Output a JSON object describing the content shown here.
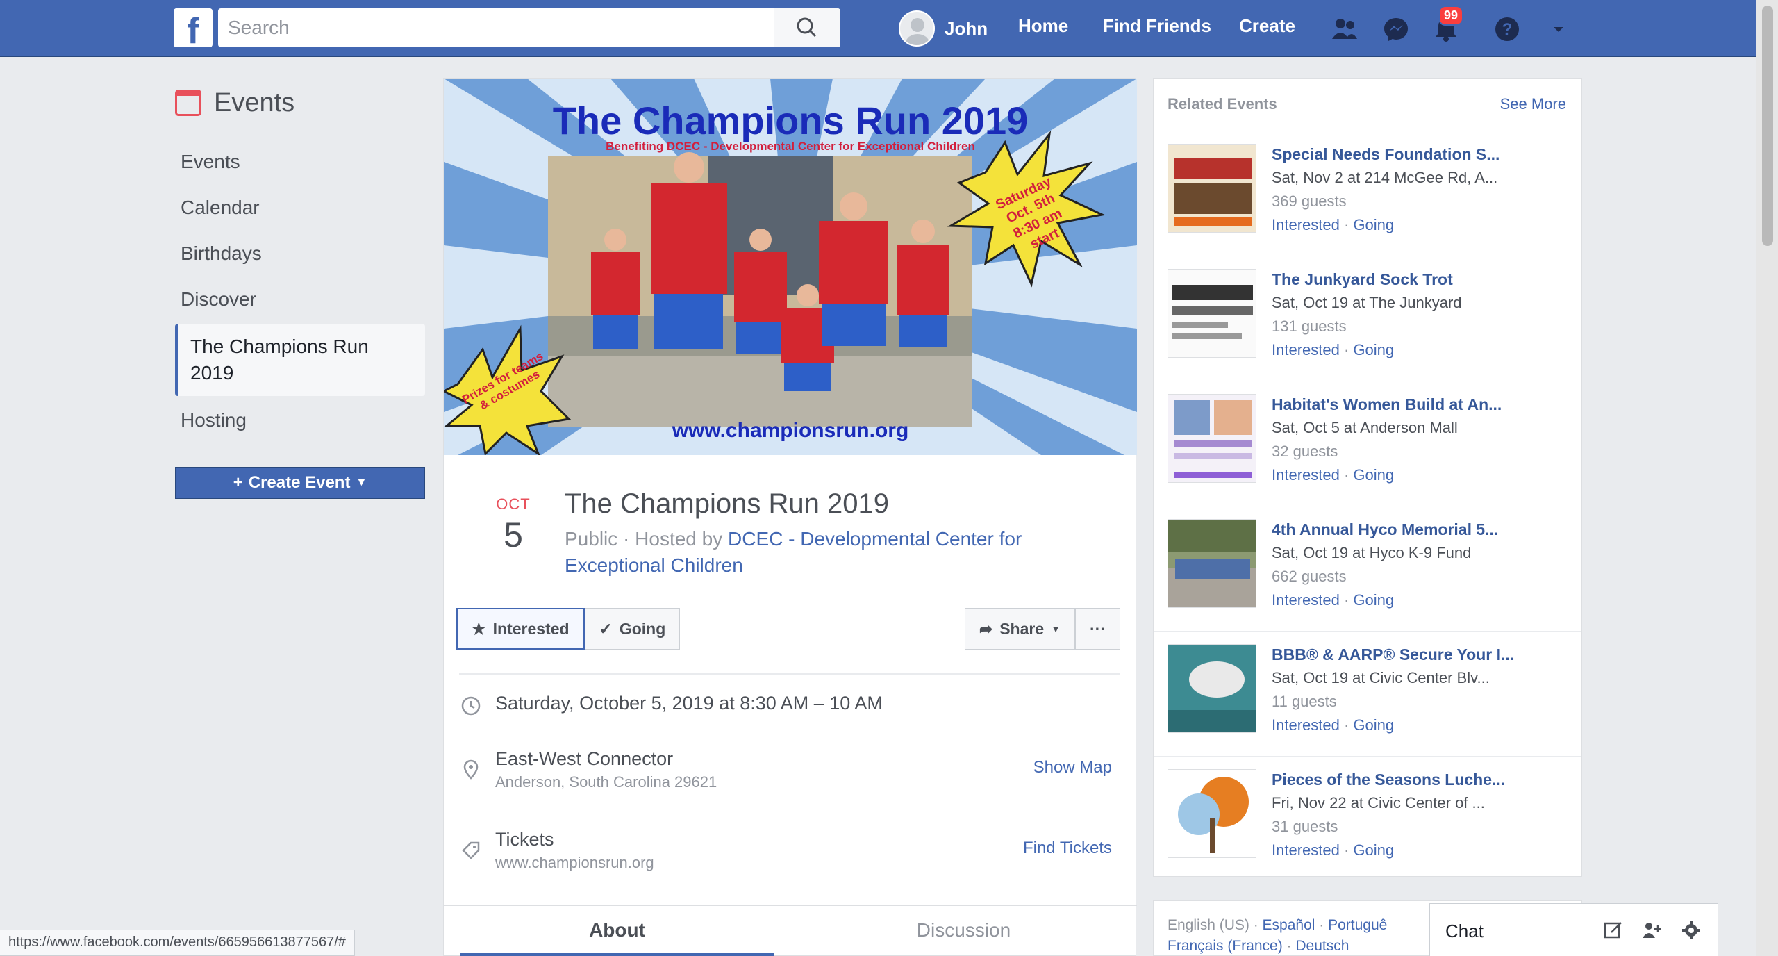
{
  "nav": {
    "logo": "f",
    "search_placeholder": "Search",
    "user_name": "John",
    "home": "Home",
    "find_friends": "Find Friends",
    "create": "Create",
    "notification_count": "99"
  },
  "left": {
    "heading": "Events",
    "items": [
      "Events",
      "Calendar",
      "Birthdays",
      "Discover"
    ],
    "active_item": "The Champions Run 2019",
    "hosting": "Hosting",
    "create_button": "Create Event"
  },
  "event": {
    "cover": {
      "title": "The Champions Run 2019",
      "subtitle": "Benefiting DCEC - Developmental Center for Exceptional Children",
      "burst_right": "Saturday Oct. 5th 8:30 am start",
      "burst_left": "Prizes for teams & costumes",
      "url": "www.championsrun.org"
    },
    "month": "OCT",
    "day": "5",
    "title": "The Champions Run 2019",
    "host_prefix": "Public · Hosted by ",
    "host_name": "DCEC - Developmental Center for Exceptional Children",
    "interested": "Interested",
    "going": "Going",
    "share": "Share",
    "more": "···",
    "datetime": "Saturday, October 5, 2019 at 8:30 AM – 10 AM",
    "location_name": "East-West Connector",
    "location_address": "Anderson, South Carolina 29621",
    "show_map": "Show Map",
    "tickets_label": "Tickets",
    "tickets_url": "www.championsrun.org",
    "find_tickets": "Find Tickets",
    "tab_about": "About",
    "tab_discussion": "Discussion"
  },
  "related": {
    "title": "Related Events",
    "see_more": "See More",
    "items": [
      {
        "name": "Special Needs Foundation S...",
        "meta": "Sat, Nov 2 at 214 McGee Rd, A...",
        "guests": "369 guests",
        "interested": "Interested",
        "going": "Going"
      },
      {
        "name": "The Junkyard Sock Trot",
        "meta": "Sat, Oct 19 at The Junkyard",
        "guests": "131 guests",
        "interested": "Interested",
        "going": "Going"
      },
      {
        "name": "Habitat's Women Build at An...",
        "meta": "Sat, Oct 5 at Anderson Mall",
        "guests": "32 guests",
        "interested": "Interested",
        "going": "Going"
      },
      {
        "name": "4th Annual Hyco Memorial 5...",
        "meta": "Sat, Oct 19 at Hyco K-9 Fund",
        "guests": "662 guests",
        "interested": "Interested",
        "going": "Going"
      },
      {
        "name": "BBB® & AARP® Secure Your I...",
        "meta": "Sat, Oct 19 at Civic Center Blv...",
        "guests": "11 guests",
        "interested": "Interested",
        "going": "Going"
      },
      {
        "name": "Pieces of the Seasons Luche...",
        "meta": "Fri, Nov 22 at Civic Center of ...",
        "guests": "31 guests",
        "interested": "Interested",
        "going": "Going"
      }
    ]
  },
  "footer_langs": {
    "line1": [
      "English (US)",
      "Español",
      "Portuguê"
    ],
    "line2": [
      "Français (France)",
      "Deutsch"
    ]
  },
  "chat": {
    "label": "Chat"
  },
  "status_url": "https://www.facebook.com/events/665956613877567/#",
  "colors": {
    "brand": "#4267b2",
    "accent_red": "#e8505b",
    "badge": "#fa3e3e"
  }
}
